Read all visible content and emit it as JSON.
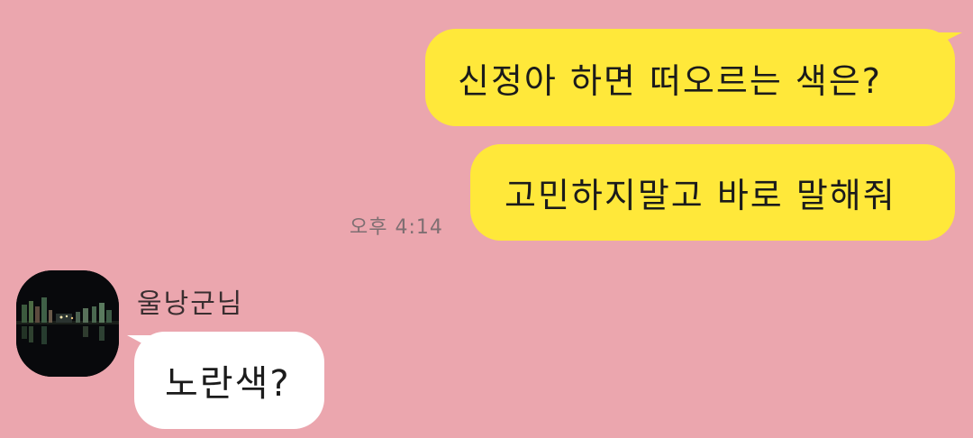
{
  "chat": {
    "messages": [
      {
        "direction": "outgoing",
        "text": "신정아 하면 떠오르는 색은?"
      },
      {
        "direction": "outgoing",
        "text": "고민하지말고 바로 말해줘"
      },
      {
        "direction": "incoming",
        "sender": "울낭군님",
        "text": "노란색?"
      }
    ],
    "outgoing_time": "오후 4:14",
    "colors": {
      "background": "#eba6ae",
      "outgoing_bubble": "#ffe83a",
      "incoming_bubble": "#ffffff"
    }
  },
  "avatar": {
    "icon": "night-city-photo"
  }
}
